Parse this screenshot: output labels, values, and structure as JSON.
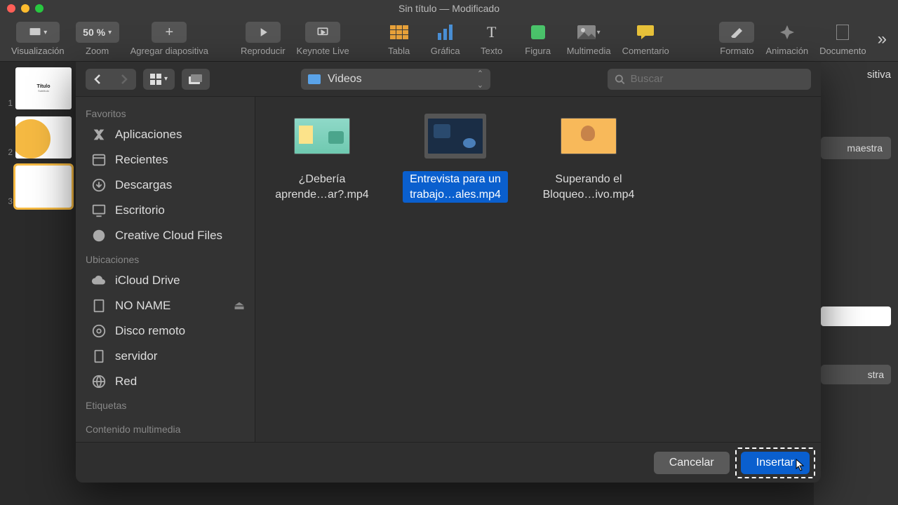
{
  "window": {
    "title": "Sin título — Modificado"
  },
  "toolbar": {
    "visualizacion": "Visualización",
    "zoom_value": "50 %",
    "zoom": "Zoom",
    "add_slide": "Agregar diapositiva",
    "play": "Reproducir",
    "keynote_live": "Keynote Live",
    "table": "Tabla",
    "chart": "Gráfica",
    "text": "Texto",
    "shape": "Figura",
    "media": "Multimedia",
    "comment": "Comentario",
    "format": "Formato",
    "animation": "Animación",
    "document": "Documento"
  },
  "slides": [
    {
      "num": "1"
    },
    {
      "num": "2"
    },
    {
      "num": "3"
    }
  ],
  "inspector": {
    "tab": "sitiva",
    "btn1": "maestra",
    "btn2": "stra"
  },
  "dialog": {
    "path": "Videos",
    "search_placeholder": "Buscar",
    "sidebar": {
      "favorites": "Favoritos",
      "apps": "Aplicaciones",
      "recents": "Recientes",
      "downloads": "Descargas",
      "desktop": "Escritorio",
      "creative_cloud": "Creative Cloud Files",
      "locations": "Ubicaciones",
      "icloud": "iCloud Drive",
      "noname": "NO NAME",
      "remote": "Disco remoto",
      "server": "servidor",
      "network": "Red",
      "tags": "Etiquetas",
      "media_content": "Contenido multimedia"
    },
    "files": [
      {
        "label": "¿Debería aprende…ar?.mp4"
      },
      {
        "label": "Entrevista para un trabajo…ales.mp4"
      },
      {
        "label": "Superando el Bloqueo…ivo.mp4"
      }
    ],
    "cancel": "Cancelar",
    "insert": "Insertar"
  }
}
